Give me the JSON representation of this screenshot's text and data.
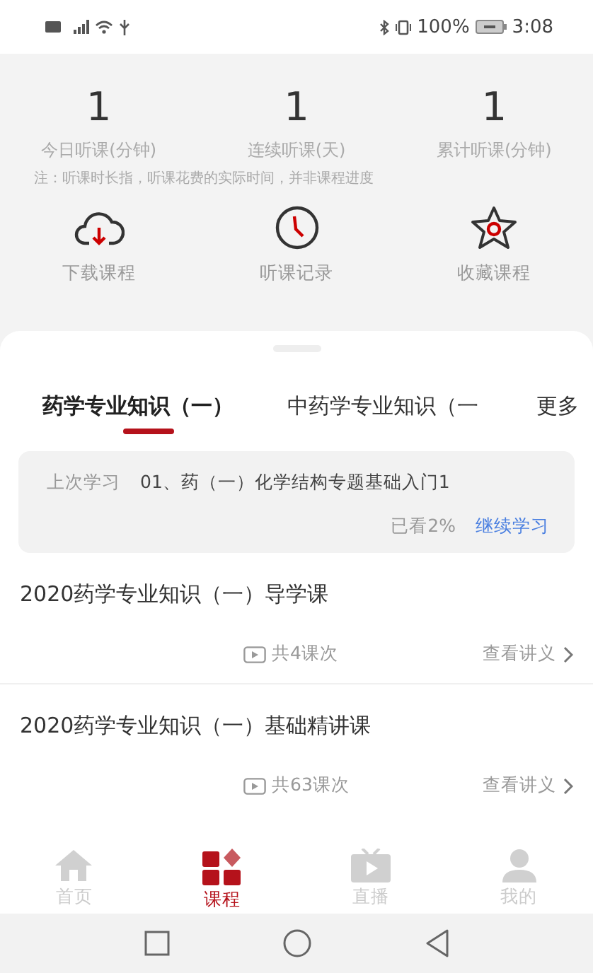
{
  "status_bar": {
    "battery": "100%",
    "time": "3:08"
  },
  "stats": [
    {
      "value": "1",
      "label": "今日听课(分钟)"
    },
    {
      "value": "1",
      "label": "连续听课(天)"
    },
    {
      "value": "1",
      "label": "累计听课(分钟)"
    }
  ],
  "note": "注：听课时长指，听课花费的实际时间，并非课程进度",
  "shortcuts": [
    {
      "kind": "download",
      "label": "下载课程"
    },
    {
      "kind": "history",
      "label": "听课记录"
    },
    {
      "kind": "favorite",
      "label": "收藏课程"
    }
  ],
  "tabs": [
    {
      "label": "药学专业知识（一）",
      "selected": true
    },
    {
      "label": "中药学专业知识（一",
      "selected": false
    }
  ],
  "more": "更多",
  "last_study": {
    "label": "上次学习",
    "title": "01、药（一）化学结构专题基础入门1",
    "progress": "已看2%",
    "action": "继续学习"
  },
  "courses": [
    {
      "title": "2020药学专业知识（一）导学课",
      "count": "共4课次",
      "handout": "查看讲义"
    },
    {
      "title": "2020药学专业知识（一）基础精讲课",
      "count": "共63课次",
      "handout": "查看讲义"
    }
  ],
  "nav": [
    {
      "kind": "home",
      "label": "首页",
      "selected": false
    },
    {
      "kind": "course",
      "label": "课程",
      "selected": true
    },
    {
      "kind": "live",
      "label": "直播",
      "selected": false
    },
    {
      "kind": "mine",
      "label": "我的",
      "selected": false
    }
  ]
}
